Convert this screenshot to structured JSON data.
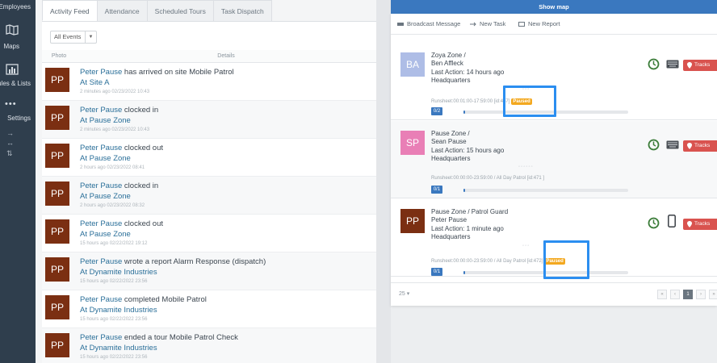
{
  "sidebar": {
    "items": [
      {
        "label": "Employees"
      },
      {
        "label": "Maps"
      },
      {
        "label": "Rules & Lists"
      },
      {
        "label": "Settings"
      }
    ]
  },
  "tabs": [
    {
      "label": "Activity Feed",
      "active": true
    },
    {
      "label": "Attendance"
    },
    {
      "label": "Scheduled Tours"
    },
    {
      "label": "Task Dispatch"
    }
  ],
  "filter": {
    "selected": "All Events"
  },
  "feed_columns": {
    "photo": "Photo",
    "details": "Details"
  },
  "feed": [
    {
      "initials": "PP",
      "name": "Peter Pause",
      "action": " has arrived on site Mobile Patrol",
      "location": "At Site A",
      "time": "2 minutes ago   02/23/2022 10:43"
    },
    {
      "initials": "PP",
      "name": "Peter Pause",
      "action": " clocked in",
      "location": "At Pause Zone",
      "time": "2 minutes ago   02/23/2022 10:43"
    },
    {
      "initials": "PP",
      "name": "Peter Pause",
      "action": " clocked out",
      "location": "At Pause Zone",
      "time": "2 hours ago   02/23/2022 08:41"
    },
    {
      "initials": "PP",
      "name": "Peter Pause",
      "action": " clocked in",
      "location": "At Pause Zone",
      "time": "2 hours ago   02/23/2022 08:32"
    },
    {
      "initials": "PP",
      "name": "Peter Pause",
      "action": " clocked out",
      "location": "At Pause Zone",
      "time": "15 hours ago   02/22/2022 19:12"
    },
    {
      "initials": "PP",
      "name": "Peter Pause",
      "action": " wrote a report Alarm Response (dispatch)",
      "location": "At Dynamite Industries",
      "time": "15 hours ago   02/22/2022 23:56"
    },
    {
      "initials": "PP",
      "name": "Peter Pause",
      "action": " completed Mobile Patrol",
      "location": "At Dynamite Industries",
      "time": "15 hours ago   02/22/2022 23:56"
    },
    {
      "initials": "PP",
      "name": "Peter Pause",
      "action": " ended a tour Mobile Patrol Check",
      "location": "At Dynamite Industries",
      "time": "15 hours ago   02/22/2022 23:56"
    }
  ],
  "map": {
    "show_map_label": "Show map"
  },
  "actions": {
    "broadcast": "Broadcast Message",
    "new_task": "New Task",
    "new_report": "New Report"
  },
  "employees": [
    {
      "initials": "BA",
      "avatar_color": "#aebde6",
      "zone": "Zoya Zone /",
      "name": "Ben Affleck",
      "last_action": "Last Action: 14 hours ago",
      "site": "Headquarters",
      "runsheet": "Runsheet:00:01:00-17:59:00 [id:467]",
      "status": "Paused",
      "count": "0/2",
      "device": "keyboard"
    },
    {
      "initials": "SP",
      "avatar_color": "#e97fb6",
      "zone": "Pause Zone /",
      "name": "Sean Pause",
      "last_action": "Last Action: 15 hours ago",
      "site": "Headquarters",
      "runsheet": "Runsheet:00:00:00-23:59:00 / All Day Patrol [id:471 ]",
      "status": "",
      "count": "0/1",
      "device": "keyboard"
    },
    {
      "initials": "PP",
      "avatar_color": "#7b2f12",
      "zone": "Pause Zone / Patrol Guard",
      "name": "Peter Pause",
      "last_action": "Last Action: 1 minute ago",
      "site": "Headquarters",
      "runsheet": "Runsheet:00:00:00-23:59:00 / All Day Patrol [id:472]",
      "status": "Paused",
      "count": "0/1",
      "device": "phone"
    }
  ],
  "tracks_label": "Tracks",
  "pagination": {
    "page_size": "25",
    "current_page": "1"
  },
  "colors": {
    "accent": "#3a78bf",
    "sidebar": "#2f3e4d",
    "paused": "#f3a81f",
    "tracks": "#d9534f",
    "highlight": "#2b8ef0"
  }
}
